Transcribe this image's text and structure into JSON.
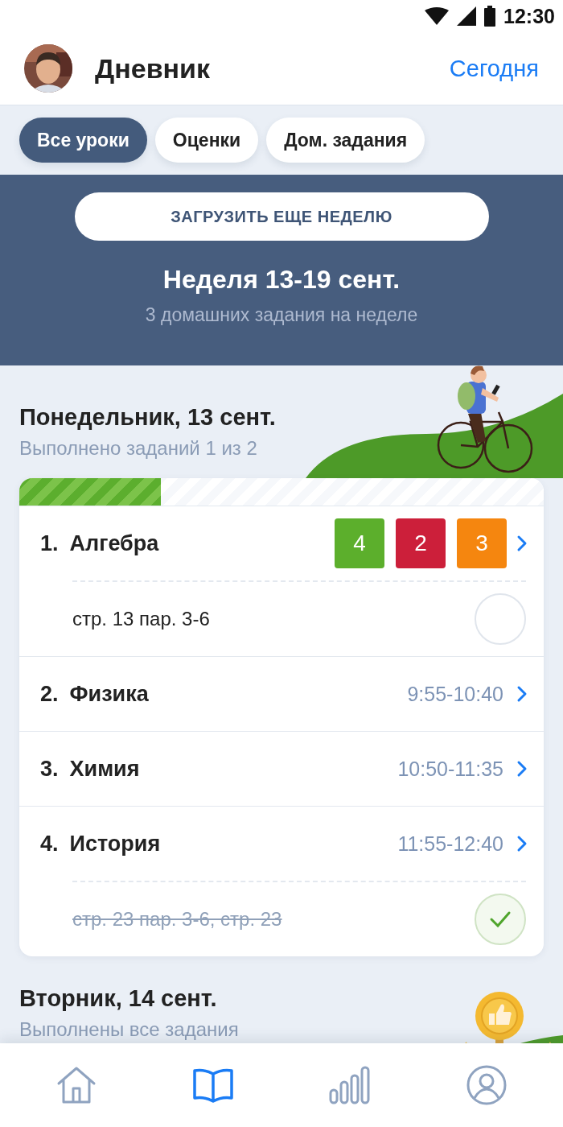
{
  "status_bar": {
    "time": "12:30"
  },
  "header": {
    "title": "Дневник",
    "today_link": "Сегодня"
  },
  "tabs": [
    {
      "label": "Все уроки",
      "selected": true
    },
    {
      "label": "Оценки",
      "selected": false
    },
    {
      "label": "Дом. задания",
      "selected": false
    }
  ],
  "week": {
    "load_button": "ЗАГРУЗИТЬ ЕЩЕ НЕДЕЛЮ",
    "title": "Неделя 13-19 сент.",
    "subtitle": "3 домашних задания на неделе"
  },
  "days": [
    {
      "title": "Понедельник, 13 сент.",
      "subtitle": "Выполнено заданий 1 из 2",
      "kind": "cyclist",
      "progress": {
        "level": 0.27
      },
      "lessons": [
        {
          "number": "1.",
          "name": "Алгебра",
          "grades": [
            {
              "value": "4",
              "color": "#5caf2c"
            },
            {
              "value": "2",
              "color": "#cc1f3a"
            },
            {
              "value": "3",
              "color": "#f5860f"
            }
          ],
          "homework": {
            "text": "стр. 13 пар. 3-6",
            "done": false
          }
        },
        {
          "number": "2.",
          "name": "Физика",
          "time": "9:55-10:40"
        },
        {
          "number": "3.",
          "name": "Химия",
          "time": "10:50-11:35"
        },
        {
          "number": "4.",
          "name": "История",
          "time": "11:55-12:40",
          "homework": {
            "text": "стр. 23 пар. 3-6, стр. 23",
            "done": true
          }
        }
      ]
    },
    {
      "title": "Вторник, 14 сент.",
      "subtitle": "Выполнены все задания",
      "kind": "trophy"
    }
  ],
  "nav": [
    {
      "kind": "home",
      "selected": false
    },
    {
      "kind": "book",
      "selected": true
    },
    {
      "kind": "chart",
      "selected": false
    },
    {
      "kind": "profile",
      "selected": false
    }
  ]
}
